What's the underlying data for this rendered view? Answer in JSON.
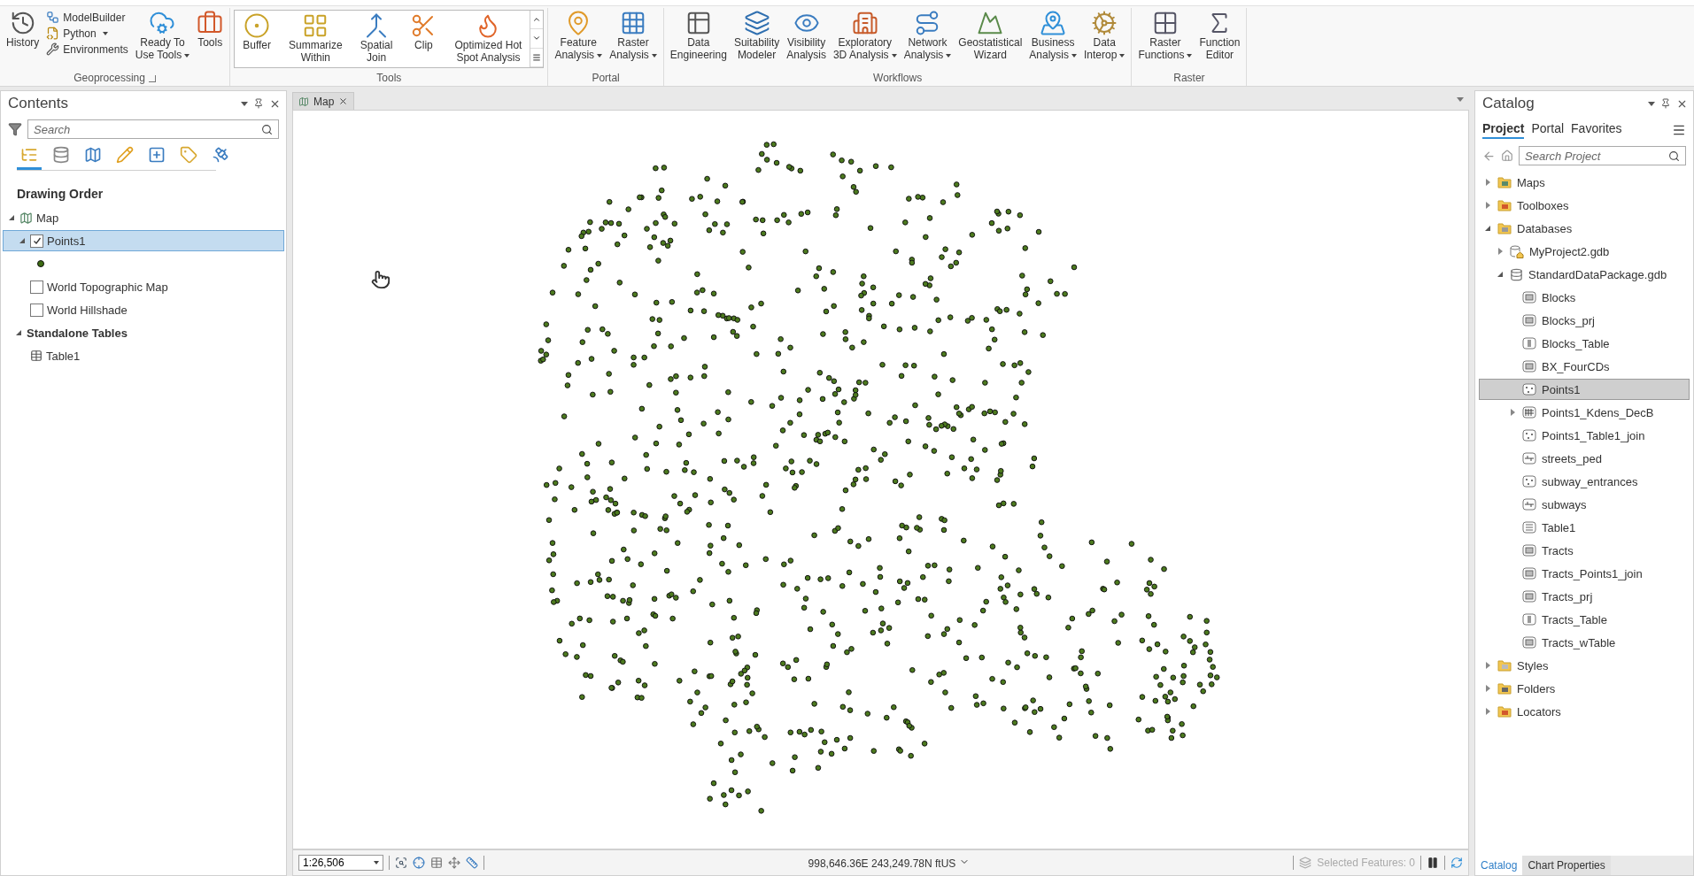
{
  "ribbon": {
    "groups": [
      {
        "title": "Geoprocessing",
        "launcher": true,
        "kind": "buttons",
        "items": [
          {
            "kind": "large",
            "label": "History"
          },
          {
            "kind": "small",
            "label": "ModelBuilder"
          },
          {
            "kind": "small",
            "label": "Python",
            "dropdown": true
          },
          {
            "kind": "small",
            "label": "Environments"
          },
          {
            "kind": "large",
            "label": "Ready To\nUse Tools",
            "dropdown": true
          },
          {
            "kind": "large",
            "label": "Tools"
          }
        ]
      },
      {
        "title": "Tools",
        "kind": "gallery",
        "items": [
          {
            "kind": "large",
            "label": "Buffer"
          },
          {
            "kind": "large",
            "label": "Summarize\nWithin"
          },
          {
            "kind": "large",
            "label": "Spatial\nJoin"
          },
          {
            "kind": "large",
            "label": "Clip"
          },
          {
            "kind": "large",
            "label": "Optimized Hot\nSpot Analysis"
          }
        ]
      },
      {
        "title": "Portal",
        "kind": "buttons",
        "items": [
          {
            "kind": "large",
            "label": "Feature\nAnalysis",
            "dropdown": true
          },
          {
            "kind": "large",
            "label": "Raster\nAnalysis",
            "dropdown": true
          }
        ]
      },
      {
        "title": "Workflows",
        "kind": "buttons",
        "items": [
          {
            "kind": "large",
            "label": "Data\nEngineering"
          },
          {
            "kind": "large",
            "label": "Suitability\nModeler"
          },
          {
            "kind": "large",
            "label": "Visibility\nAnalysis"
          },
          {
            "kind": "large",
            "label": "Exploratory\n3D Analysis",
            "dropdown": true
          },
          {
            "kind": "large",
            "label": "Network\nAnalysis",
            "dropdown": true
          },
          {
            "kind": "large",
            "label": "Geostatistical\nWizard"
          },
          {
            "kind": "large",
            "label": "Business\nAnalysis",
            "dropdown": true
          },
          {
            "kind": "large",
            "label": "Data\nInterop",
            "dropdown": true
          }
        ]
      },
      {
        "title": "Raster",
        "kind": "buttons",
        "items": [
          {
            "kind": "large",
            "label": "Raster\nFunctions",
            "dropdown": true
          },
          {
            "kind": "large",
            "label": "Function\nEditor"
          }
        ]
      }
    ]
  },
  "contents": {
    "title": "Contents",
    "search": {
      "placeholder": "Search"
    },
    "view_tabs": [
      {
        "selected": true
      },
      {
        "selected": false
      },
      {
        "selected": false
      },
      {
        "selected": false
      },
      {
        "selected": false
      },
      {
        "selected": false
      },
      {
        "selected": false
      }
    ],
    "heading": "Drawing Order",
    "tree": [
      {
        "kind": "map",
        "label": "Map",
        "expanded": true,
        "selected": false,
        "children": [
          {
            "kind": "layer",
            "label": "Points1",
            "checked": true,
            "selected": true,
            "expanded": true,
            "symbol": true
          },
          {
            "kind": "layer",
            "label": "World Topographic Map",
            "checked": false,
            "selected": false
          },
          {
            "kind": "layer",
            "label": "World Hillshade",
            "checked": false,
            "selected": false
          }
        ]
      },
      {
        "kind": "group",
        "label": "Standalone Tables",
        "expanded": true,
        "selected": false,
        "children": [
          {
            "kind": "table",
            "label": "Table1",
            "selected": false
          }
        ]
      }
    ]
  },
  "map_view": {
    "tab": "Map",
    "scale": "1:26,506",
    "coordinates": "998,646.36E 243,249.78N ftUS",
    "selected_features": "Selected Features: 0"
  },
  "catalog": {
    "title": "Catalog",
    "tabs": [
      {
        "label": "Project",
        "selected": true
      },
      {
        "label": "Portal",
        "selected": false
      },
      {
        "label": "Favorites",
        "selected": false
      }
    ],
    "search": {
      "placeholder": "Search Project"
    },
    "tree": [
      {
        "kind": "maps",
        "label": "Maps",
        "expanded": false,
        "selected": false
      },
      {
        "kind": "toolboxes",
        "label": "Toolboxes",
        "expanded": false,
        "selected": false
      },
      {
        "kind": "databases",
        "label": "Databases",
        "expanded": true,
        "selected": false,
        "children": [
          {
            "kind": "home-gdb",
            "label": "MyProject2.gdb",
            "expanded": false,
            "selected": false
          },
          {
            "kind": "gdb",
            "label": "StandardDataPackage.gdb",
            "expanded": true,
            "selected": false,
            "children": [
              {
                "kind": "polygon",
                "label": "Blocks",
                "selected": false
              },
              {
                "kind": "polygon",
                "label": "Blocks_prj",
                "selected": false
              },
              {
                "kind": "table",
                "label": "Blocks_Table",
                "selected": false
              },
              {
                "kind": "polygon",
                "label": "BX_FourCDs",
                "selected": false
              },
              {
                "kind": "point",
                "label": "Points1",
                "selected": true
              },
              {
                "kind": "raster",
                "label": "Points1_Kdens_DecB",
                "expanded": false,
                "selected": false
              },
              {
                "kind": "point",
                "label": "Points1_Table1_join",
                "selected": false
              },
              {
                "kind": "line",
                "label": "streets_ped",
                "selected": false
              },
              {
                "kind": "point",
                "label": "subway_entrances",
                "selected": false
              },
              {
                "kind": "line",
                "label": "subways",
                "selected": false
              },
              {
                "kind": "table2",
                "label": "Table1",
                "selected": false
              },
              {
                "kind": "polygon",
                "label": "Tracts",
                "selected": false
              },
              {
                "kind": "polygon",
                "label": "Tracts_Points1_join",
                "selected": false
              },
              {
                "kind": "polygon",
                "label": "Tracts_prj",
                "selected": false
              },
              {
                "kind": "table",
                "label": "Tracts_Table",
                "selected": false
              },
              {
                "kind": "polygon",
                "label": "Tracts_wTable",
                "selected": false
              }
            ]
          }
        ]
      },
      {
        "kind": "styles",
        "label": "Styles",
        "expanded": false,
        "selected": false
      },
      {
        "kind": "folders",
        "label": "Folders",
        "expanded": false,
        "selected": false
      },
      {
        "kind": "locators",
        "label": "Locators",
        "expanded": false,
        "selected": false
      }
    ],
    "bottom_tabs": [
      {
        "label": "Catalog",
        "selected": true
      },
      {
        "label": "Chart Properties",
        "selected": false
      }
    ]
  }
}
